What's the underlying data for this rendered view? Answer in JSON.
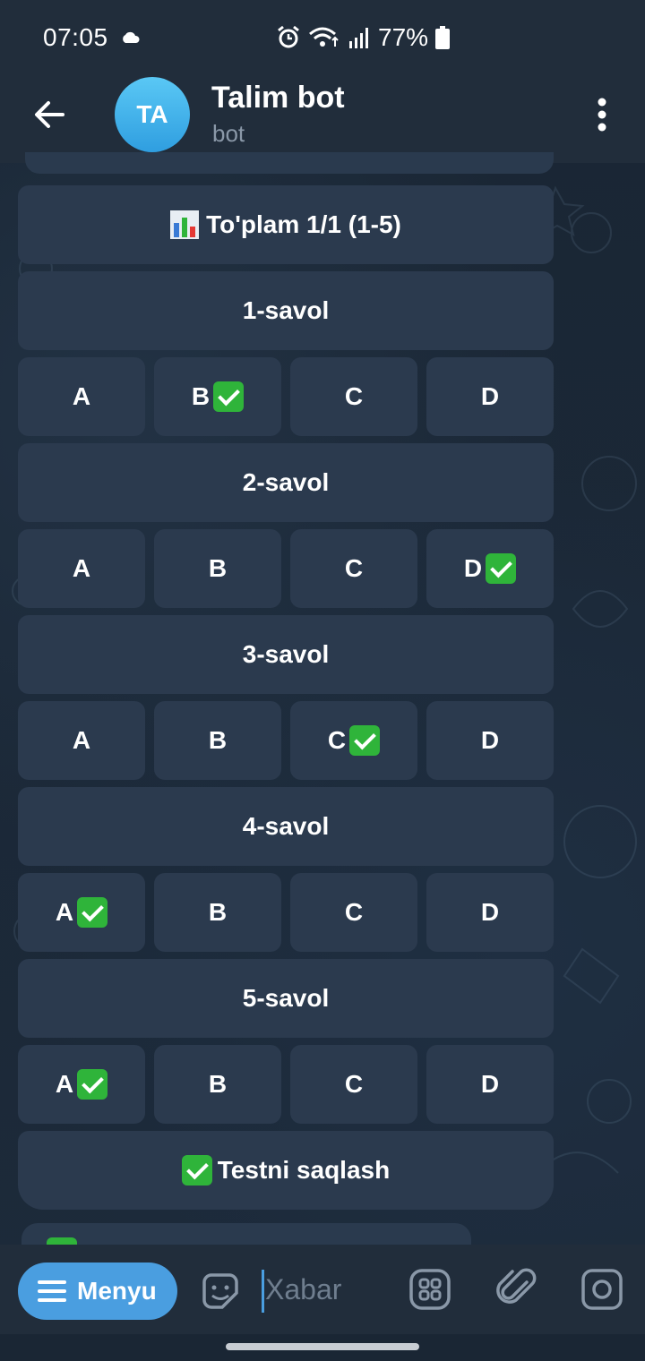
{
  "status": {
    "time": "07:05",
    "battery": "77%"
  },
  "header": {
    "avatar_initials": "TA",
    "title": "Talim bot",
    "subtitle": "bot"
  },
  "keyboard": {
    "title": "To'plam 1/1 (1-5)",
    "questions": [
      {
        "label": "1-savol",
        "options": [
          "A",
          "B",
          "C",
          "D"
        ],
        "correct": "B"
      },
      {
        "label": "2-savol",
        "options": [
          "A",
          "B",
          "C",
          "D"
        ],
        "correct": "D"
      },
      {
        "label": "3-savol",
        "options": [
          "A",
          "B",
          "C",
          "D"
        ],
        "correct": "C"
      },
      {
        "label": "4-savol",
        "options": [
          "A",
          "B",
          "C",
          "D"
        ],
        "correct": "A"
      },
      {
        "label": "5-savol",
        "options": [
          "A",
          "B",
          "C",
          "D"
        ],
        "correct": "A"
      }
    ],
    "save_label": "Testni saqlash"
  },
  "input": {
    "menu_label": "Menyu",
    "placeholder": "Xabar"
  },
  "colors": {
    "accent": "#4a9ee0",
    "check": "#2fb43a",
    "button_bg": "#2b3a4e",
    "header_bg": "#212d3b"
  },
  "icons": [
    "cloud-icon",
    "alarm-icon",
    "wifi-icon",
    "signal-icon",
    "battery-icon",
    "back-arrow-icon",
    "more-vert-icon",
    "chart-icon",
    "check-icon",
    "hamburger-icon",
    "sticker-icon",
    "commands-icon",
    "attach-icon",
    "camera-icon"
  ]
}
